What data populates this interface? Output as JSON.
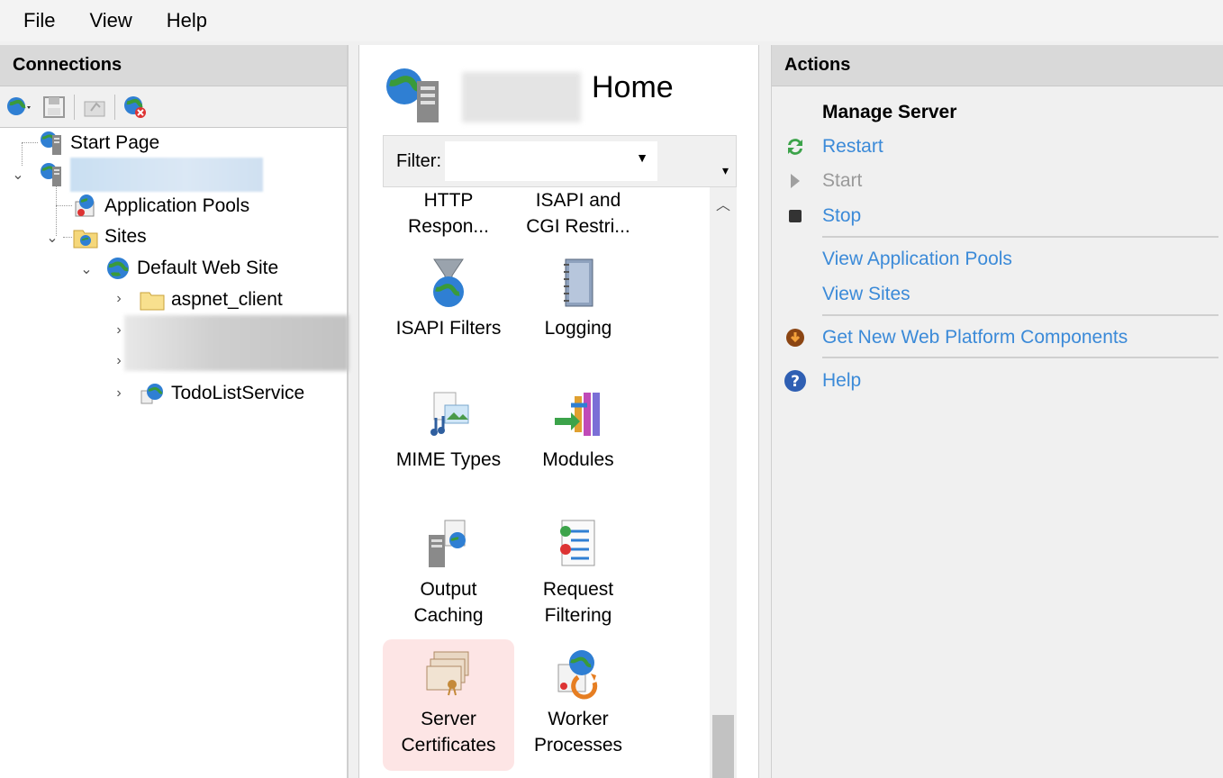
{
  "menu": {
    "file": "File",
    "view": "View",
    "help": "Help"
  },
  "connections": {
    "title": "Connections",
    "tree": {
      "start_page": "Start Page",
      "app_pools": "Application Pools",
      "sites": "Sites",
      "default_site": "Default Web Site",
      "aspnet_client": "aspnet_client",
      "todo_service": "TodoListService"
    }
  },
  "center": {
    "title": "Home",
    "filter_label": "Filter:",
    "features": {
      "http": "HTTP Respon...",
      "isapi_cgi": "ISAPI and CGI Restri...",
      "isapi_filters": "ISAPI Filters",
      "logging": "Logging",
      "mime": "MIME Types",
      "modules": "Modules",
      "output": "Output Caching",
      "request": "Request Filtering",
      "server_cert": "Server Certificates",
      "worker": "Worker Processes"
    }
  },
  "actions": {
    "title": "Actions",
    "manage_server": "Manage Server",
    "restart": "Restart",
    "start": "Start",
    "stop": "Stop",
    "view_pools": "View Application Pools",
    "view_sites": "View Sites",
    "get_components": "Get New Web Platform Components",
    "help": "Help"
  },
  "colors": {
    "link": "#3b8ad8",
    "selected": "#fde5e5",
    "header": "#d9d9d9"
  }
}
